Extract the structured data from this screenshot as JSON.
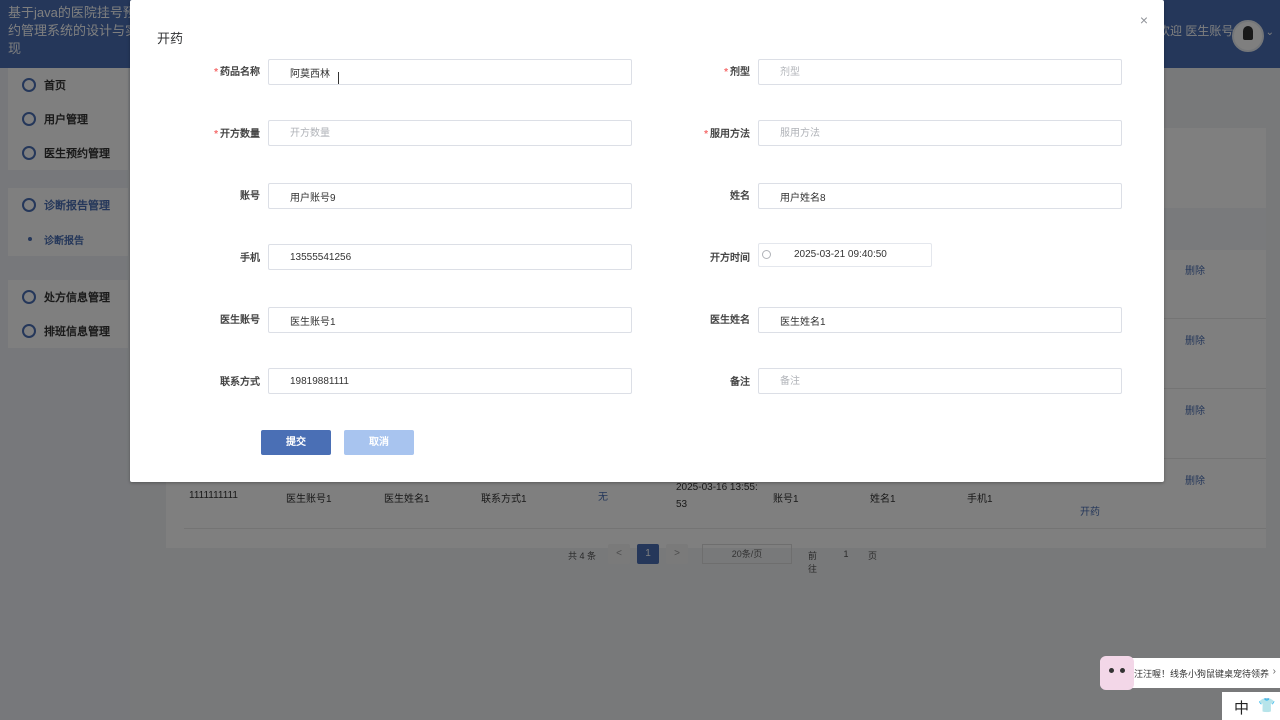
{
  "app": {
    "title": "基于java的医院挂号预约管理系统的设计与实现",
    "welcome": "欢迎 医生账号1"
  },
  "sidebar": {
    "items": [
      {
        "label": "首页",
        "icon": "home-icon"
      },
      {
        "label": "用户管理",
        "icon": "user-icon"
      },
      {
        "label": "医生预约管理",
        "icon": "calendar-icon"
      },
      {
        "label": "诊断报告管理",
        "icon": "report-icon"
      },
      {
        "label": "诊断报告",
        "icon": "dot-icon"
      },
      {
        "label": "处方信息管理",
        "icon": "prescription-icon"
      },
      {
        "label": "排班信息管理",
        "icon": "schedule-icon"
      }
    ]
  },
  "table": {
    "action_delete": "删除",
    "row": {
      "c1": "1111111111",
      "c2": "医生账号1",
      "c3": "医生姓名1",
      "c4": "联系方式1",
      "c5": "无",
      "c6": "2025-03-16 13:55:",
      "c6b": "53",
      "c7": "账号1",
      "c8": "姓名1",
      "c9": "手机1",
      "action_prescribe": "开药"
    }
  },
  "pagination": {
    "total": "共 4 条",
    "prev": "<",
    "current": "1",
    "next": ">",
    "page_size": "20条/页",
    "goto_label": "前往",
    "goto_value": "1",
    "page_suffix": "页"
  },
  "dialog": {
    "title": "开药",
    "close": "×",
    "fields": {
      "drug_name": {
        "label": "药品名称",
        "value": "阿莫西林",
        "required": "*"
      },
      "dosage_form": {
        "label": "剂型",
        "placeholder": "剂型",
        "required": "*"
      },
      "quantity": {
        "label": "开方数量",
        "placeholder": "开方数量",
        "required": "*"
      },
      "usage": {
        "label": "服用方法",
        "placeholder": "服用方法",
        "required": "*"
      },
      "account": {
        "label": "账号",
        "value": "用户账号9"
      },
      "name": {
        "label": "姓名",
        "value": "用户姓名8"
      },
      "phone": {
        "label": "手机",
        "value": "13555541256"
      },
      "prescribe_time": {
        "label": "开方时间",
        "value": "2025-03-21 09:40:50"
      },
      "doctor_account": {
        "label": "医生账号",
        "value": "医生账号1"
      },
      "doctor_name": {
        "label": "医生姓名",
        "value": "医生姓名1"
      },
      "contact": {
        "label": "联系方式",
        "value": "19819881111"
      },
      "remark": {
        "label": "备注",
        "placeholder": "备注"
      }
    },
    "submit": "提交",
    "cancel": "取消"
  },
  "desktop_widget": {
    "banner_text": "汪汪喔！线条小狗鼠键桌宠待领养",
    "arrow": "›",
    "ime_label": "中",
    "ime_icon": "👕"
  }
}
